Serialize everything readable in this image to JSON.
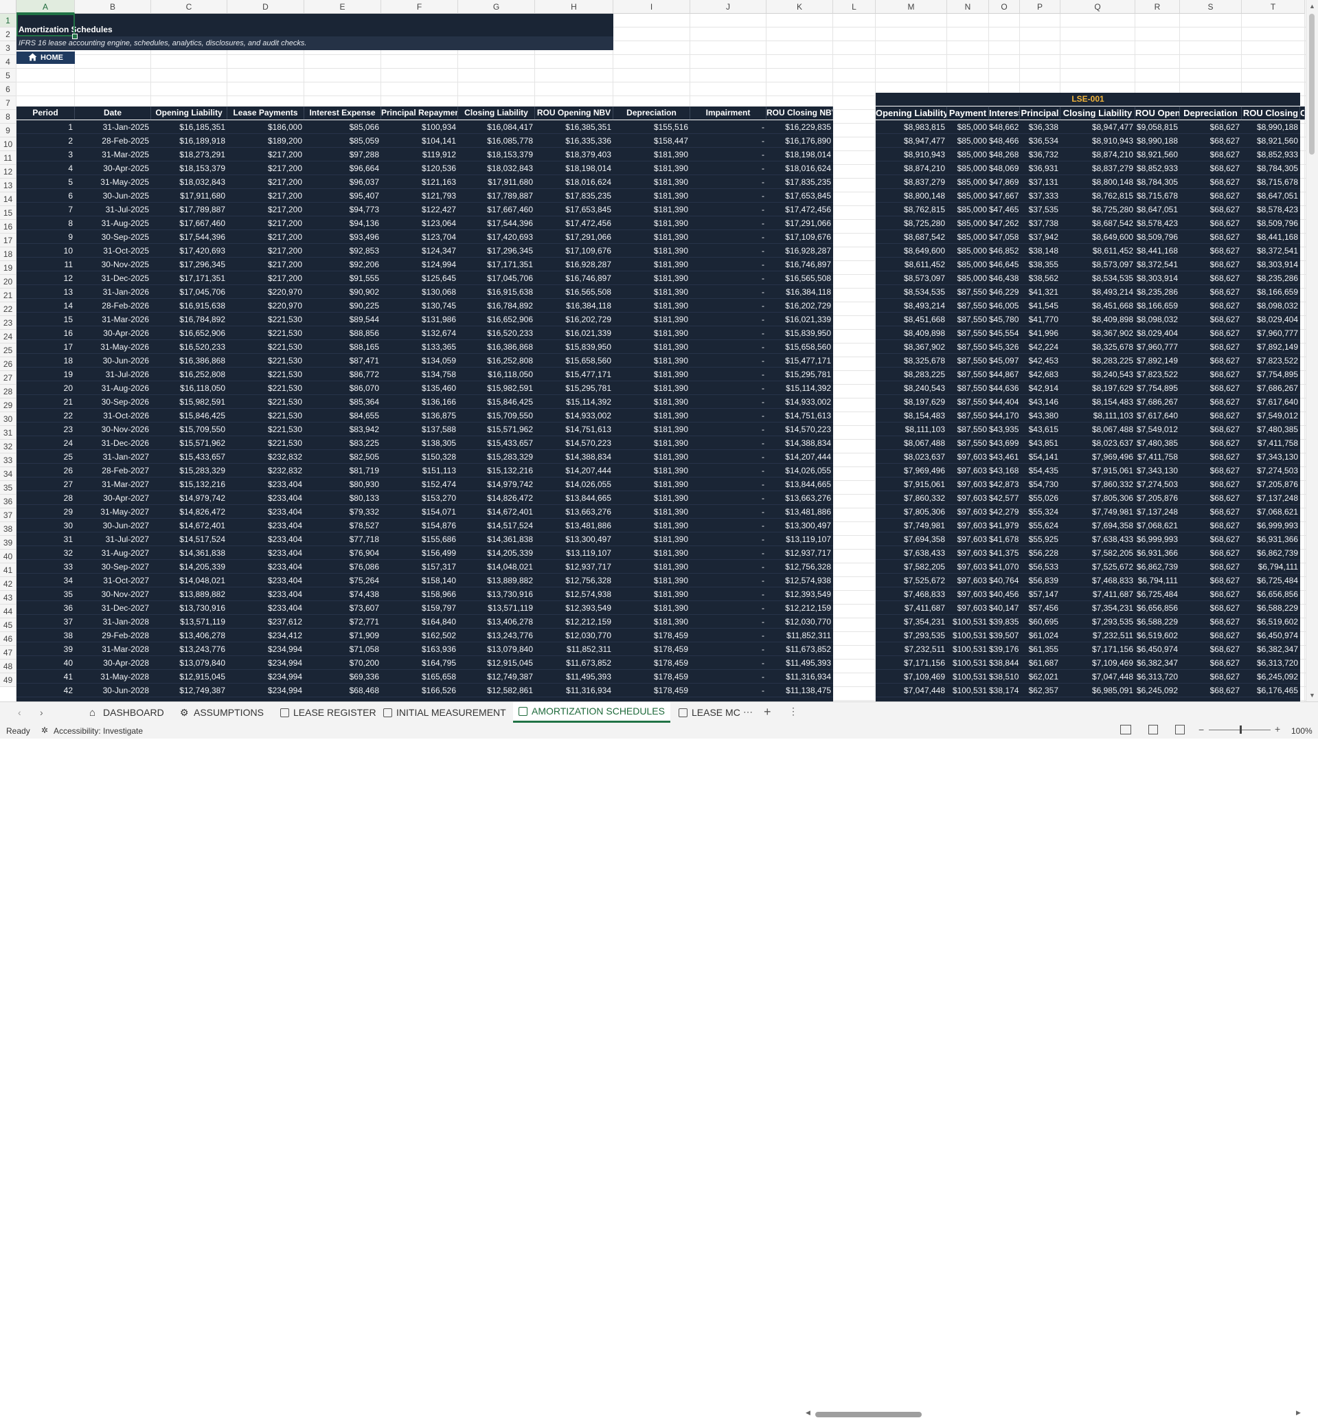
{
  "columns": [
    "A",
    "B",
    "C",
    "D",
    "E",
    "F",
    "G",
    "H",
    "I",
    "J",
    "K",
    "L",
    "M",
    "N",
    "O",
    "P",
    "Q",
    "R",
    "S",
    "T"
  ],
  "title": "Amortization Schedules",
  "subtitle": "IFRS 16 lease accounting engine, schedules, analytics, disclosures, and audit checks.",
  "home_label": "HOME",
  "left_headers": [
    "Period",
    "Date",
    "Opening Liability",
    "Lease Payments",
    "Interest Expense",
    "Principal Repayment",
    "Closing Liability",
    "ROU Opening NBV",
    "Depreciation",
    "Impairment",
    "ROU Closing NBV"
  ],
  "right_group_label": "LSE-001",
  "right_headers": [
    "Opening Liability",
    "Payment",
    "Interest",
    "Principal",
    "Closing Liability",
    "ROU Opening",
    "Depreciation",
    "ROU Closing",
    "C"
  ],
  "left_rows": [
    [
      "1",
      "31-Jan-2025",
      "$16,185,351",
      "$186,000",
      "$85,066",
      "$100,934",
      "$16,084,417",
      "$16,385,351",
      "$155,516",
      "-",
      "$16,229,835"
    ],
    [
      "2",
      "28-Feb-2025",
      "$16,189,918",
      "$189,200",
      "$85,059",
      "$104,141",
      "$16,085,778",
      "$16,335,336",
      "$158,447",
      "-",
      "$16,176,890"
    ],
    [
      "3",
      "31-Mar-2025",
      "$18,273,291",
      "$217,200",
      "$97,288",
      "$119,912",
      "$18,153,379",
      "$18,379,403",
      "$181,390",
      "-",
      "$18,198,014"
    ],
    [
      "4",
      "30-Apr-2025",
      "$18,153,379",
      "$217,200",
      "$96,664",
      "$120,536",
      "$18,032,843",
      "$18,198,014",
      "$181,390",
      "-",
      "$18,016,624"
    ],
    [
      "5",
      "31-May-2025",
      "$18,032,843",
      "$217,200",
      "$96,037",
      "$121,163",
      "$17,911,680",
      "$18,016,624",
      "$181,390",
      "-",
      "$17,835,235"
    ],
    [
      "6",
      "30-Jun-2025",
      "$17,911,680",
      "$217,200",
      "$95,407",
      "$121,793",
      "$17,789,887",
      "$17,835,235",
      "$181,390",
      "-",
      "$17,653,845"
    ],
    [
      "7",
      "31-Jul-2025",
      "$17,789,887",
      "$217,200",
      "$94,773",
      "$122,427",
      "$17,667,460",
      "$17,653,845",
      "$181,390",
      "-",
      "$17,472,456"
    ],
    [
      "8",
      "31-Aug-2025",
      "$17,667,460",
      "$217,200",
      "$94,136",
      "$123,064",
      "$17,544,396",
      "$17,472,456",
      "$181,390",
      "-",
      "$17,291,066"
    ],
    [
      "9",
      "30-Sep-2025",
      "$17,544,396",
      "$217,200",
      "$93,496",
      "$123,704",
      "$17,420,693",
      "$17,291,066",
      "$181,390",
      "-",
      "$17,109,676"
    ],
    [
      "10",
      "31-Oct-2025",
      "$17,420,693",
      "$217,200",
      "$92,853",
      "$124,347",
      "$17,296,345",
      "$17,109,676",
      "$181,390",
      "-",
      "$16,928,287"
    ],
    [
      "11",
      "30-Nov-2025",
      "$17,296,345",
      "$217,200",
      "$92,206",
      "$124,994",
      "$17,171,351",
      "$16,928,287",
      "$181,390",
      "-",
      "$16,746,897"
    ],
    [
      "12",
      "31-Dec-2025",
      "$17,171,351",
      "$217,200",
      "$91,555",
      "$125,645",
      "$17,045,706",
      "$16,746,897",
      "$181,390",
      "-",
      "$16,565,508"
    ],
    [
      "13",
      "31-Jan-2026",
      "$17,045,706",
      "$220,970",
      "$90,902",
      "$130,068",
      "$16,915,638",
      "$16,565,508",
      "$181,390",
      "-",
      "$16,384,118"
    ],
    [
      "14",
      "28-Feb-2026",
      "$16,915,638",
      "$220,970",
      "$90,225",
      "$130,745",
      "$16,784,892",
      "$16,384,118",
      "$181,390",
      "-",
      "$16,202,729"
    ],
    [
      "15",
      "31-Mar-2026",
      "$16,784,892",
      "$221,530",
      "$89,544",
      "$131,986",
      "$16,652,906",
      "$16,202,729",
      "$181,390",
      "-",
      "$16,021,339"
    ],
    [
      "16",
      "30-Apr-2026",
      "$16,652,906",
      "$221,530",
      "$88,856",
      "$132,674",
      "$16,520,233",
      "$16,021,339",
      "$181,390",
      "-",
      "$15,839,950"
    ],
    [
      "17",
      "31-May-2026",
      "$16,520,233",
      "$221,530",
      "$88,165",
      "$133,365",
      "$16,386,868",
      "$15,839,950",
      "$181,390",
      "-",
      "$15,658,560"
    ],
    [
      "18",
      "30-Jun-2026",
      "$16,386,868",
      "$221,530",
      "$87,471",
      "$134,059",
      "$16,252,808",
      "$15,658,560",
      "$181,390",
      "-",
      "$15,477,171"
    ],
    [
      "19",
      "31-Jul-2026",
      "$16,252,808",
      "$221,530",
      "$86,772",
      "$134,758",
      "$16,118,050",
      "$15,477,171",
      "$181,390",
      "-",
      "$15,295,781"
    ],
    [
      "20",
      "31-Aug-2026",
      "$16,118,050",
      "$221,530",
      "$86,070",
      "$135,460",
      "$15,982,591",
      "$15,295,781",
      "$181,390",
      "-",
      "$15,114,392"
    ],
    [
      "21",
      "30-Sep-2026",
      "$15,982,591",
      "$221,530",
      "$85,364",
      "$136,166",
      "$15,846,425",
      "$15,114,392",
      "$181,390",
      "-",
      "$14,933,002"
    ],
    [
      "22",
      "31-Oct-2026",
      "$15,846,425",
      "$221,530",
      "$84,655",
      "$136,875",
      "$15,709,550",
      "$14,933,002",
      "$181,390",
      "-",
      "$14,751,613"
    ],
    [
      "23",
      "30-Nov-2026",
      "$15,709,550",
      "$221,530",
      "$83,942",
      "$137,588",
      "$15,571,962",
      "$14,751,613",
      "$181,390",
      "-",
      "$14,570,223"
    ],
    [
      "24",
      "31-Dec-2026",
      "$15,571,962",
      "$221,530",
      "$83,225",
      "$138,305",
      "$15,433,657",
      "$14,570,223",
      "$181,390",
      "-",
      "$14,388,834"
    ],
    [
      "25",
      "31-Jan-2027",
      "$15,433,657",
      "$232,832",
      "$82,505",
      "$150,328",
      "$15,283,329",
      "$14,388,834",
      "$181,390",
      "-",
      "$14,207,444"
    ],
    [
      "26",
      "28-Feb-2027",
      "$15,283,329",
      "$232,832",
      "$81,719",
      "$151,113",
      "$15,132,216",
      "$14,207,444",
      "$181,390",
      "-",
      "$14,026,055"
    ],
    [
      "27",
      "31-Mar-2027",
      "$15,132,216",
      "$233,404",
      "$80,930",
      "$152,474",
      "$14,979,742",
      "$14,026,055",
      "$181,390",
      "-",
      "$13,844,665"
    ],
    [
      "28",
      "30-Apr-2027",
      "$14,979,742",
      "$233,404",
      "$80,133",
      "$153,270",
      "$14,826,472",
      "$13,844,665",
      "$181,390",
      "-",
      "$13,663,276"
    ],
    [
      "29",
      "31-May-2027",
      "$14,826,472",
      "$233,404",
      "$79,332",
      "$154,071",
      "$14,672,401",
      "$13,663,276",
      "$181,390",
      "-",
      "$13,481,886"
    ],
    [
      "30",
      "30-Jun-2027",
      "$14,672,401",
      "$233,404",
      "$78,527",
      "$154,876",
      "$14,517,524",
      "$13,481,886",
      "$181,390",
      "-",
      "$13,300,497"
    ],
    [
      "31",
      "31-Jul-2027",
      "$14,517,524",
      "$233,404",
      "$77,718",
      "$155,686",
      "$14,361,838",
      "$13,300,497",
      "$181,390",
      "-",
      "$13,119,107"
    ],
    [
      "32",
      "31-Aug-2027",
      "$14,361,838",
      "$233,404",
      "$76,904",
      "$156,499",
      "$14,205,339",
      "$13,119,107",
      "$181,390",
      "-",
      "$12,937,717"
    ],
    [
      "33",
      "30-Sep-2027",
      "$14,205,339",
      "$233,404",
      "$76,086",
      "$157,317",
      "$14,048,021",
      "$12,937,717",
      "$181,390",
      "-",
      "$12,756,328"
    ],
    [
      "34",
      "31-Oct-2027",
      "$14,048,021",
      "$233,404",
      "$75,264",
      "$158,140",
      "$13,889,882",
      "$12,756,328",
      "$181,390",
      "-",
      "$12,574,938"
    ],
    [
      "35",
      "30-Nov-2027",
      "$13,889,882",
      "$233,404",
      "$74,438",
      "$158,966",
      "$13,730,916",
      "$12,574,938",
      "$181,390",
      "-",
      "$12,393,549"
    ],
    [
      "36",
      "31-Dec-2027",
      "$13,730,916",
      "$233,404",
      "$73,607",
      "$159,797",
      "$13,571,119",
      "$12,393,549",
      "$181,390",
      "-",
      "$12,212,159"
    ],
    [
      "37",
      "31-Jan-2028",
      "$13,571,119",
      "$237,612",
      "$72,771",
      "$164,840",
      "$13,406,278",
      "$12,212,159",
      "$181,390",
      "-",
      "$12,030,770"
    ],
    [
      "38",
      "29-Feb-2028",
      "$13,406,278",
      "$234,412",
      "$71,909",
      "$162,502",
      "$13,243,776",
      "$12,030,770",
      "$178,459",
      "-",
      "$11,852,311"
    ],
    [
      "39",
      "31-Mar-2028",
      "$13,243,776",
      "$234,994",
      "$71,058",
      "$163,936",
      "$13,079,840",
      "$11,852,311",
      "$178,459",
      "-",
      "$11,673,852"
    ],
    [
      "40",
      "30-Apr-2028",
      "$13,079,840",
      "$234,994",
      "$70,200",
      "$164,795",
      "$12,915,045",
      "$11,673,852",
      "$178,459",
      "-",
      "$11,495,393"
    ],
    [
      "41",
      "31-May-2028",
      "$12,915,045",
      "$234,994",
      "$69,336",
      "$165,658",
      "$12,749,387",
      "$11,495,393",
      "$178,459",
      "-",
      "$11,316,934"
    ],
    [
      "42",
      "30-Jun-2028",
      "$12,749,387",
      "$234,994",
      "$68,468",
      "$166,526",
      "$12,582,861",
      "$11,316,934",
      "$178,459",
      "-",
      "$11,138,475"
    ]
  ],
  "right_rows": [
    [
      "$8,983,815",
      "$85,000",
      "$48,662",
      "$36,338",
      "$8,947,477",
      "$9,058,815",
      "$68,627",
      "$8,990,188"
    ],
    [
      "$8,947,477",
      "$85,000",
      "$48,466",
      "$36,534",
      "$8,910,943",
      "$8,990,188",
      "$68,627",
      "$8,921,560"
    ],
    [
      "$8,910,943",
      "$85,000",
      "$48,268",
      "$36,732",
      "$8,874,210",
      "$8,921,560",
      "$68,627",
      "$8,852,933"
    ],
    [
      "$8,874,210",
      "$85,000",
      "$48,069",
      "$36,931",
      "$8,837,279",
      "$8,852,933",
      "$68,627",
      "$8,784,305"
    ],
    [
      "$8,837,279",
      "$85,000",
      "$47,869",
      "$37,131",
      "$8,800,148",
      "$8,784,305",
      "$68,627",
      "$8,715,678"
    ],
    [
      "$8,800,148",
      "$85,000",
      "$47,667",
      "$37,333",
      "$8,762,815",
      "$8,715,678",
      "$68,627",
      "$8,647,051"
    ],
    [
      "$8,762,815",
      "$85,000",
      "$47,465",
      "$37,535",
      "$8,725,280",
      "$8,647,051",
      "$68,627",
      "$8,578,423"
    ],
    [
      "$8,725,280",
      "$85,000",
      "$47,262",
      "$37,738",
      "$8,687,542",
      "$8,578,423",
      "$68,627",
      "$8,509,796"
    ],
    [
      "$8,687,542",
      "$85,000",
      "$47,058",
      "$37,942",
      "$8,649,600",
      "$8,509,796",
      "$68,627",
      "$8,441,168"
    ],
    [
      "$8,649,600",
      "$85,000",
      "$46,852",
      "$38,148",
      "$8,611,452",
      "$8,441,168",
      "$68,627",
      "$8,372,541"
    ],
    [
      "$8,611,452",
      "$85,000",
      "$46,645",
      "$38,355",
      "$8,573,097",
      "$8,372,541",
      "$68,627",
      "$8,303,914"
    ],
    [
      "$8,573,097",
      "$85,000",
      "$46,438",
      "$38,562",
      "$8,534,535",
      "$8,303,914",
      "$68,627",
      "$8,235,286"
    ],
    [
      "$8,534,535",
      "$87,550",
      "$46,229",
      "$41,321",
      "$8,493,214",
      "$8,235,286",
      "$68,627",
      "$8,166,659"
    ],
    [
      "$8,493,214",
      "$87,550",
      "$46,005",
      "$41,545",
      "$8,451,668",
      "$8,166,659",
      "$68,627",
      "$8,098,032"
    ],
    [
      "$8,451,668",
      "$87,550",
      "$45,780",
      "$41,770",
      "$8,409,898",
      "$8,098,032",
      "$68,627",
      "$8,029,404"
    ],
    [
      "$8,409,898",
      "$87,550",
      "$45,554",
      "$41,996",
      "$8,367,902",
      "$8,029,404",
      "$68,627",
      "$7,960,777"
    ],
    [
      "$8,367,902",
      "$87,550",
      "$45,326",
      "$42,224",
      "$8,325,678",
      "$7,960,777",
      "$68,627",
      "$7,892,149"
    ],
    [
      "$8,325,678",
      "$87,550",
      "$45,097",
      "$42,453",
      "$8,283,225",
      "$7,892,149",
      "$68,627",
      "$7,823,522"
    ],
    [
      "$8,283,225",
      "$87,550",
      "$44,867",
      "$42,683",
      "$8,240,543",
      "$7,823,522",
      "$68,627",
      "$7,754,895"
    ],
    [
      "$8,240,543",
      "$87,550",
      "$44,636",
      "$42,914",
      "$8,197,629",
      "$7,754,895",
      "$68,627",
      "$7,686,267"
    ],
    [
      "$8,197,629",
      "$87,550",
      "$44,404",
      "$43,146",
      "$8,154,483",
      "$7,686,267",
      "$68,627",
      "$7,617,640"
    ],
    [
      "$8,154,483",
      "$87,550",
      "$44,170",
      "$43,380",
      "$8,111,103",
      "$7,617,640",
      "$68,627",
      "$7,549,012"
    ],
    [
      "$8,111,103",
      "$87,550",
      "$43,935",
      "$43,615",
      "$8,067,488",
      "$7,549,012",
      "$68,627",
      "$7,480,385"
    ],
    [
      "$8,067,488",
      "$87,550",
      "$43,699",
      "$43,851",
      "$8,023,637",
      "$7,480,385",
      "$68,627",
      "$7,411,758"
    ],
    [
      "$8,023,637",
      "$97,603",
      "$43,461",
      "$54,141",
      "$7,969,496",
      "$7,411,758",
      "$68,627",
      "$7,343,130"
    ],
    [
      "$7,969,496",
      "$97,603",
      "$43,168",
      "$54,435",
      "$7,915,061",
      "$7,343,130",
      "$68,627",
      "$7,274,503"
    ],
    [
      "$7,915,061",
      "$97,603",
      "$42,873",
      "$54,730",
      "$7,860,332",
      "$7,274,503",
      "$68,627",
      "$7,205,876"
    ],
    [
      "$7,860,332",
      "$97,603",
      "$42,577",
      "$55,026",
      "$7,805,306",
      "$7,205,876",
      "$68,627",
      "$7,137,248"
    ],
    [
      "$7,805,306",
      "$97,603",
      "$42,279",
      "$55,324",
      "$7,749,981",
      "$7,137,248",
      "$68,627",
      "$7,068,621"
    ],
    [
      "$7,749,981",
      "$97,603",
      "$41,979",
      "$55,624",
      "$7,694,358",
      "$7,068,621",
      "$68,627",
      "$6,999,993"
    ],
    [
      "$7,694,358",
      "$97,603",
      "$41,678",
      "$55,925",
      "$7,638,433",
      "$6,999,993",
      "$68,627",
      "$6,931,366"
    ],
    [
      "$7,638,433",
      "$97,603",
      "$41,375",
      "$56,228",
      "$7,582,205",
      "$6,931,366",
      "$68,627",
      "$6,862,739"
    ],
    [
      "$7,582,205",
      "$97,603",
      "$41,070",
      "$56,533",
      "$7,525,672",
      "$6,862,739",
      "$68,627",
      "$6,794,111"
    ],
    [
      "$7,525,672",
      "$97,603",
      "$40,764",
      "$56,839",
      "$7,468,833",
      "$6,794,111",
      "$68,627",
      "$6,725,484"
    ],
    [
      "$7,468,833",
      "$97,603",
      "$40,456",
      "$57,147",
      "$7,411,687",
      "$6,725,484",
      "$68,627",
      "$6,656,856"
    ],
    [
      "$7,411,687",
      "$97,603",
      "$40,147",
      "$57,456",
      "$7,354,231",
      "$6,656,856",
      "$68,627",
      "$6,588,229"
    ],
    [
      "$7,354,231",
      "$100,531",
      "$39,835",
      "$60,695",
      "$7,293,535",
      "$6,588,229",
      "$68,627",
      "$6,519,602"
    ],
    [
      "$7,293,535",
      "$100,531",
      "$39,507",
      "$61,024",
      "$7,232,511",
      "$6,519,602",
      "$68,627",
      "$6,450,974"
    ],
    [
      "$7,232,511",
      "$100,531",
      "$39,176",
      "$61,355",
      "$7,171,156",
      "$6,450,974",
      "$68,627",
      "$6,382,347"
    ],
    [
      "$7,171,156",
      "$100,531",
      "$38,844",
      "$61,687",
      "$7,109,469",
      "$6,382,347",
      "$68,627",
      "$6,313,720"
    ],
    [
      "$7,109,469",
      "$100,531",
      "$38,510",
      "$62,021",
      "$7,047,448",
      "$6,313,720",
      "$68,627",
      "$6,245,092"
    ],
    [
      "$7,047,448",
      "$100,531",
      "$38,174",
      "$62,357",
      "$6,985,091",
      "$6,245,092",
      "$68,627",
      "$6,176,465"
    ]
  ],
  "tabs": [
    {
      "label": "DASHBOARD",
      "icon": "home-icon"
    },
    {
      "label": "ASSUMPTIONS",
      "icon": "gear-icon"
    },
    {
      "label": "LEASE REGISTER",
      "icon": "sheet-icon"
    },
    {
      "label": "INITIAL MEASUREMENT",
      "icon": "sheet-icon"
    },
    {
      "label": "AMORTIZATION SCHEDULES",
      "icon": "sheet-icon",
      "active": true
    },
    {
      "label": "LEASE MC",
      "icon": "sheet-icon"
    }
  ],
  "status": {
    "ready": "Ready",
    "accessibility": "Accessibility: Investigate",
    "zoom": "100%"
  },
  "colors": {
    "header_dark": "#1a2535",
    "accent_green": "#217346",
    "lse_label": "#f0b43c"
  }
}
